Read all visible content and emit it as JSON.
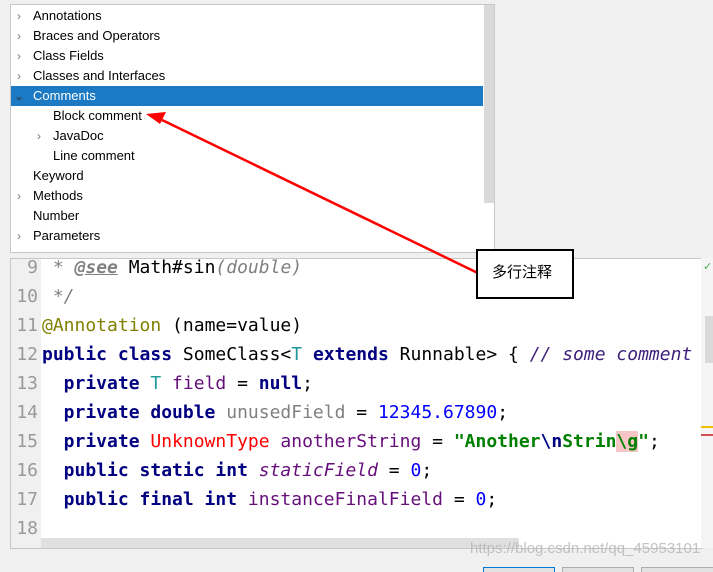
{
  "tree": {
    "items": [
      {
        "label": "Annotations",
        "expandable": true,
        "expanded": false,
        "level": 0
      },
      {
        "label": "Braces and Operators",
        "expandable": true,
        "expanded": false,
        "level": 0
      },
      {
        "label": "Class Fields",
        "expandable": true,
        "expanded": false,
        "level": 0
      },
      {
        "label": "Classes and Interfaces",
        "expandable": true,
        "expanded": false,
        "level": 0
      },
      {
        "label": "Comments",
        "expandable": true,
        "expanded": true,
        "level": 0,
        "selected": true
      },
      {
        "label": "Block comment",
        "expandable": false,
        "level": 1
      },
      {
        "label": "JavaDoc",
        "expandable": true,
        "expanded": false,
        "level": 1
      },
      {
        "label": "Line comment",
        "expandable": false,
        "level": 1
      },
      {
        "label": "Keyword",
        "expandable": false,
        "level": 0
      },
      {
        "label": "Methods",
        "expandable": true,
        "expanded": false,
        "level": 0
      },
      {
        "label": "Number",
        "expandable": false,
        "level": 0
      },
      {
        "label": "Parameters",
        "expandable": true,
        "expanded": false,
        "level": 0
      }
    ],
    "selected_color": "#1b7ac3"
  },
  "editor": {
    "lines": [
      {
        "n": "9",
        "tokens": [
          [
            "cm",
            " * "
          ],
          [
            "tag",
            "@see"
          ],
          [
            "txt",
            " Math#sin"
          ],
          [
            "cm",
            "(double)"
          ]
        ]
      },
      {
        "n": "10",
        "tokens": [
          [
            "cm",
            " */"
          ]
        ]
      },
      {
        "n": "11",
        "tokens": [
          [
            "ann",
            "@Annotation"
          ],
          [
            "txt",
            " (name=value)"
          ]
        ]
      },
      {
        "n": "12",
        "tokens": [
          [
            "kw",
            "public class "
          ],
          [
            "txt",
            "SomeClass<"
          ],
          [
            "tp",
            "T"
          ],
          [
            "kw",
            " extends "
          ],
          [
            "txt",
            "Runnable> { "
          ],
          [
            "lc",
            "// some comment"
          ]
        ]
      },
      {
        "n": "13",
        "tokens": [
          [
            "kw",
            "  private "
          ],
          [
            "tp",
            "T"
          ],
          [
            "fld",
            " field"
          ],
          [
            "txt",
            " = "
          ],
          [
            "kw",
            "null"
          ],
          [
            "txt",
            ";"
          ]
        ]
      },
      {
        "n": "14",
        "tokens": [
          [
            "kw",
            "  private double "
          ],
          [
            "unused",
            "unusedField"
          ],
          [
            "txt",
            " = "
          ],
          [
            "num",
            "12345.67890"
          ],
          [
            "txt",
            ";"
          ]
        ]
      },
      {
        "n": "15",
        "tokens": [
          [
            "kw",
            "  private "
          ],
          [
            "err",
            "UnknownType"
          ],
          [
            "fld",
            " anotherString"
          ],
          [
            "txt",
            " = "
          ],
          [
            "str",
            "\"Another"
          ],
          [
            "esc",
            "\\n"
          ],
          [
            "str",
            "Strin"
          ],
          [
            "escbad",
            "\\g"
          ],
          [
            "str",
            "\""
          ],
          [
            "txt",
            ";"
          ]
        ]
      },
      {
        "n": "16",
        "tokens": [
          [
            "kw",
            "  public static int "
          ],
          [
            "sfld",
            "staticField"
          ],
          [
            "txt",
            " = "
          ],
          [
            "num",
            "0"
          ],
          [
            "txt",
            ";"
          ]
        ]
      },
      {
        "n": "17",
        "tokens": [
          [
            "kw",
            "  public final int "
          ],
          [
            "fld",
            "instanceFinalField"
          ],
          [
            "txt",
            " = "
          ],
          [
            "num",
            "0"
          ],
          [
            "txt",
            ";"
          ]
        ]
      },
      {
        "n": "18",
        "tokens": []
      }
    ]
  },
  "annotation": {
    "callout_text": "多行注释",
    "arrow_color": "#ff0000"
  },
  "watermark": "https://blog.csdn.net/qq_45953101"
}
